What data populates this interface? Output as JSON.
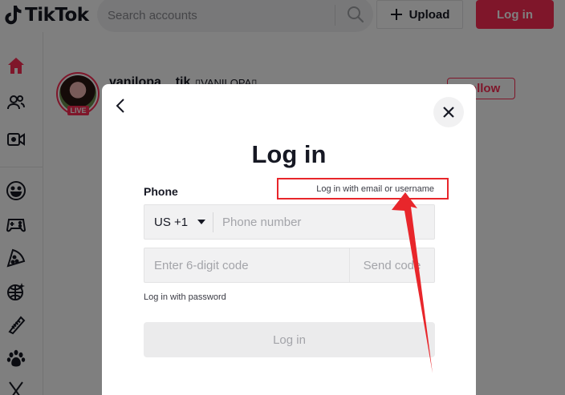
{
  "header": {
    "brand": "TikTok",
    "search_placeholder": "Search accounts",
    "upload_label": "Upload",
    "login_label": "Log in"
  },
  "sidebar": {
    "icons": [
      "home-icon",
      "following-icon",
      "live-icon",
      "comedy-icon",
      "gaming-icon",
      "food-icon",
      "dance-icon",
      "beauty-icon",
      "animals-icon",
      "sports-icon"
    ]
  },
  "feed": {
    "username": "vanilopa__tik",
    "nickname": "▯VANILOPA▯",
    "live_badge": "LIVE",
    "follow_label": "Follow"
  },
  "modal": {
    "title": "Log in",
    "phone_label": "Phone",
    "email_link": "Log in with email or username",
    "country_code": "US +1",
    "phone_placeholder": "Phone number",
    "code_placeholder": "Enter 6-digit code",
    "send_code_label": "Send code",
    "password_link": "Log in with password",
    "submit_label": "Log in"
  },
  "colors": {
    "brand_red": "#fe2c55",
    "annotation_red": "#e8262b",
    "overlay": "rgba(0,0,0,0.5)"
  }
}
